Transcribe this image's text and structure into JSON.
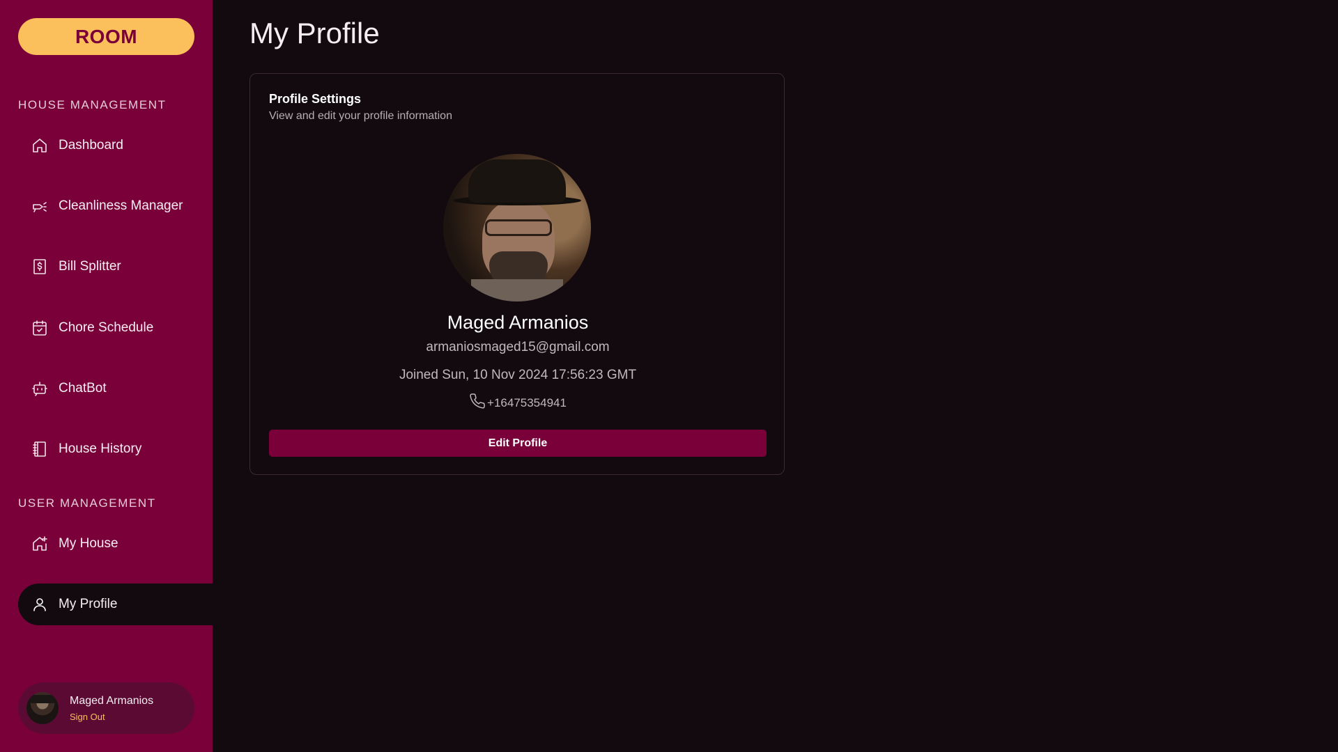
{
  "app": {
    "logo_text": "ROOM"
  },
  "sidebar": {
    "house_section_label": "HOUSE MANAGEMENT",
    "user_section_label": "USER MANAGEMENT",
    "house_items": [
      {
        "label": "Dashboard",
        "icon": "home-icon"
      },
      {
        "label": "Cleanliness Manager",
        "icon": "spray-icon"
      },
      {
        "label": "Bill Splitter",
        "icon": "receipt-dollar-icon"
      },
      {
        "label": "Chore Schedule",
        "icon": "calendar-check-icon"
      },
      {
        "label": "ChatBot",
        "icon": "bot-icon"
      },
      {
        "label": "House History",
        "icon": "notebook-icon"
      }
    ],
    "user_items": [
      {
        "label": "My House",
        "icon": "house-plus-icon"
      },
      {
        "label": "My Profile",
        "icon": "user-icon",
        "active": true
      }
    ],
    "user_chip": {
      "name": "Maged Armanios",
      "sign_out": "Sign Out"
    }
  },
  "main": {
    "page_title": "My Profile",
    "card": {
      "title": "Profile Settings",
      "subtitle": "View and edit your profile information",
      "name": "Maged Armanios",
      "email": "armaniosmaged15@gmail.com",
      "joined": "Joined Sun, 10 Nov 2024 17:56:23 GMT",
      "phone": "+16475354941",
      "edit_button": "Edit Profile"
    }
  },
  "colors": {
    "sidebar_bg": "#7a0039",
    "accent_yellow": "#fbbf5c",
    "page_bg": "#130a10",
    "button_bg": "#7a0039"
  }
}
